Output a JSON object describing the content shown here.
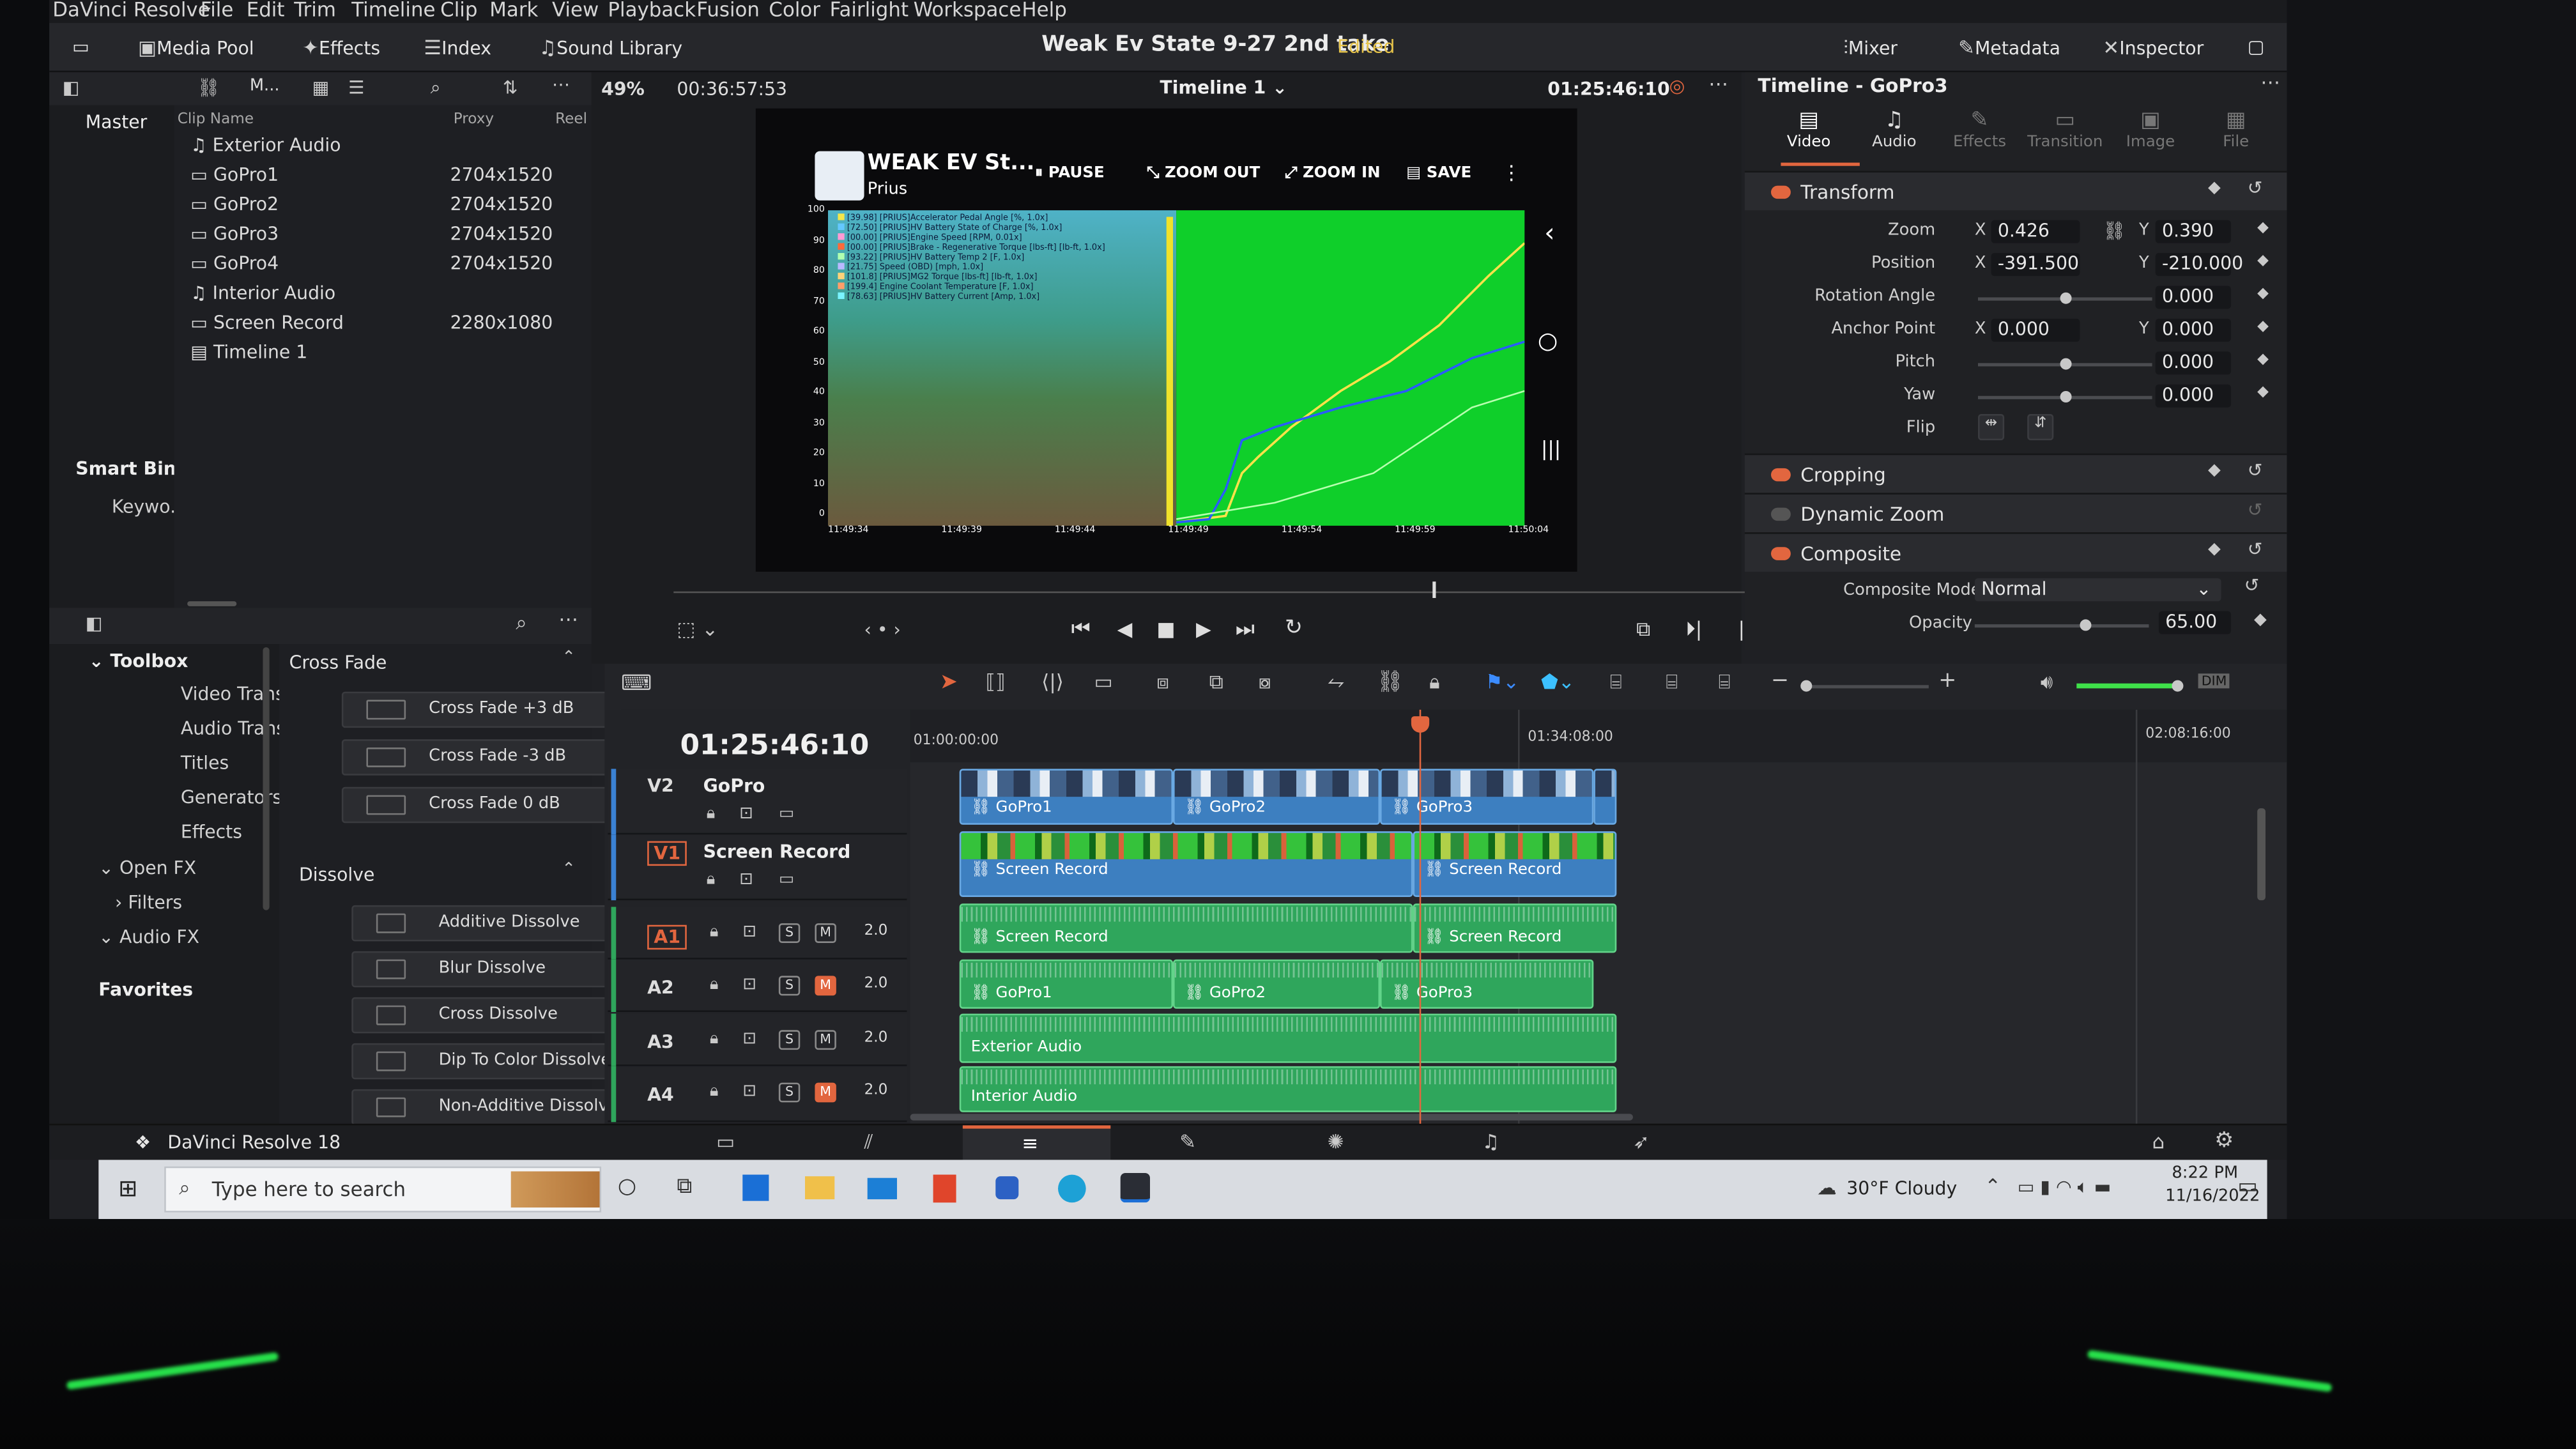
{
  "menu": [
    "DaVinci Resolve",
    "File",
    "Edit",
    "Trim",
    "Timeline",
    "Clip",
    "Mark",
    "View",
    "Playback",
    "Fusion",
    "Color",
    "Fairlight",
    "Workspace",
    "Help"
  ],
  "toolbar": {
    "media_pool": "Media Pool",
    "effects": "Effects",
    "index": "Index",
    "sound_library": "Sound Library",
    "project_title": "Weak Ev State 9-27 2nd take",
    "edited": "Edited",
    "mixer": "Mixer",
    "metadata": "Metadata",
    "inspector": "Inspector"
  },
  "viewer_bar": {
    "zoom": "49%",
    "source_tc": "00:36:57:53",
    "timeline_name": "Timeline 1",
    "record_tc": "01:25:46:10"
  },
  "media_pool": {
    "bin": "Master",
    "col_name": "Clip Name",
    "col_proxy": "Proxy",
    "col_reel": "Reel",
    "clips": [
      {
        "name": "Exterior Audio",
        "res": ""
      },
      {
        "name": "GoPro1",
        "res": "2704x1520"
      },
      {
        "name": "GoPro2",
        "res": "2704x1520"
      },
      {
        "name": "GoPro3",
        "res": "2704x1520"
      },
      {
        "name": "GoPro4",
        "res": "2704x1520"
      },
      {
        "name": "Interior Audio",
        "res": ""
      },
      {
        "name": "Screen Record",
        "res": "2280x1080"
      },
      {
        "name": "Timeline 1",
        "res": ""
      }
    ],
    "smart_bins": "Smart Bins",
    "keyword": "Keywo..."
  },
  "effects": {
    "toolbox": "Toolbox",
    "tree": [
      "Video Transiti...",
      "Audio Transiti...",
      "Titles",
      "Generators",
      "Effects"
    ],
    "open_fx": "Open FX",
    "filters": "Filters",
    "audio_fx": "Audio FX",
    "favorites": "Favorites",
    "cross_fade_hdr": "Cross Fade",
    "cross_fades": [
      "Cross Fade +3 dB",
      "Cross Fade -3 dB",
      "Cross Fade 0 dB"
    ],
    "dissolve_hdr": "Dissolve",
    "dissolves": [
      "Additive Dissolve",
      "Blur Dissolve",
      "Cross Dissolve",
      "Dip To Color Dissolve",
      "Non-Additive Dissolve"
    ]
  },
  "preview": {
    "app_title": "WEAK EV St...",
    "app_sub": "Prius",
    "pause": "PAUSE",
    "zoom_out": "ZOOM OUT",
    "zoom_in": "ZOOM IN",
    "save": "SAVE",
    "y_ticks": [
      "100",
      "90",
      "80",
      "70",
      "60",
      "50",
      "40",
      "30",
      "20",
      "10",
      "0"
    ],
    "x_ticks": [
      "11:49:34",
      "11:49:39",
      "11:49:44",
      "11:49:49",
      "11:49:54",
      "11:49:59",
      "11:50:04"
    ],
    "legend": [
      "[39.98] [PRIUS]Accelerator Pedal Angle [%, 1.0x]",
      "[72.50] [PRIUS]HV Battery State of Charge [%, 1.0x]",
      "[00.00] [PRIUS]Engine Speed [RPM, 0.01x]",
      "[00.00] [PRIUS]Brake - Regenerative Torque [lbs-ft] [lb-ft, 1.0x]",
      "[93.22] [PRIUS]HV Battery Temp 2 [F, 1.0x]",
      "[21.75] Speed (OBD) [mph, 1.0x]",
      "[101.8] [PRIUS]MG2 Torque [lbs-ft] [lb-ft, 1.0x]",
      "[199.4] Engine Coolant Temperature [F, 1.0x]",
      "[78.63] [PRIUS]HV Battery Current [Amp, 1.0x]"
    ]
  },
  "timeline": {
    "timecode": "01:25:46:10",
    "ruler": [
      "01:00:00:00",
      "01:34:08:00",
      "02:08:16:00"
    ],
    "tracks": [
      {
        "id": "V2",
        "name": "GoPro"
      },
      {
        "id": "V1",
        "name": "Screen Record"
      },
      {
        "id": "A1",
        "vol": "2.0"
      },
      {
        "id": "A2",
        "vol": "2.0"
      },
      {
        "id": "A3",
        "vol": "2.0"
      },
      {
        "id": "A4",
        "vol": "2.0"
      }
    ],
    "clips": {
      "v2": [
        "GoPro1",
        "GoPro2",
        "GoPro3"
      ],
      "v1": [
        "Screen Record",
        "Screen Record"
      ],
      "a1": [
        "Screen Record",
        "Screen Record"
      ],
      "a2": [
        "GoPro1",
        "GoPro2",
        "GoPro3"
      ],
      "a3": "Exterior Audio",
      "a4": "Interior Audio"
    },
    "s": "S",
    "m": "M"
  },
  "inspector": {
    "title": "Timeline - GoPro3",
    "tabs": [
      "Video",
      "Audio",
      "Effects",
      "Transition",
      "Image",
      "File"
    ],
    "transform": "Transform",
    "zoom_lbl": "Zoom",
    "zoom_x": "0.426",
    "zoom_y": "0.390",
    "position_lbl": "Position",
    "pos_x": "-391.500",
    "pos_y": "-210.000",
    "rotation_lbl": "Rotation Angle",
    "rotation": "0.000",
    "anchor_lbl": "Anchor Point",
    "anchor_x": "0.000",
    "anchor_y": "0.000",
    "pitch_lbl": "Pitch",
    "pitch": "0.000",
    "yaw_lbl": "Yaw",
    "yaw": "0.000",
    "flip_lbl": "Flip",
    "cropping": "Cropping",
    "dynamic_zoom": "Dynamic Zoom",
    "composite": "Composite",
    "comp_mode_lbl": "Composite Mode",
    "comp_mode": "Normal",
    "opacity_lbl": "Opacity",
    "opacity": "65.00",
    "x": "X",
    "y": "Y",
    "dim": "DIM"
  },
  "status": {
    "app": "DaVinci Resolve 18"
  },
  "taskbar": {
    "search_placeholder": "Type here to search",
    "weather": "30°F  Cloudy",
    "time": "8:22 PM",
    "date": "11/16/2022"
  }
}
